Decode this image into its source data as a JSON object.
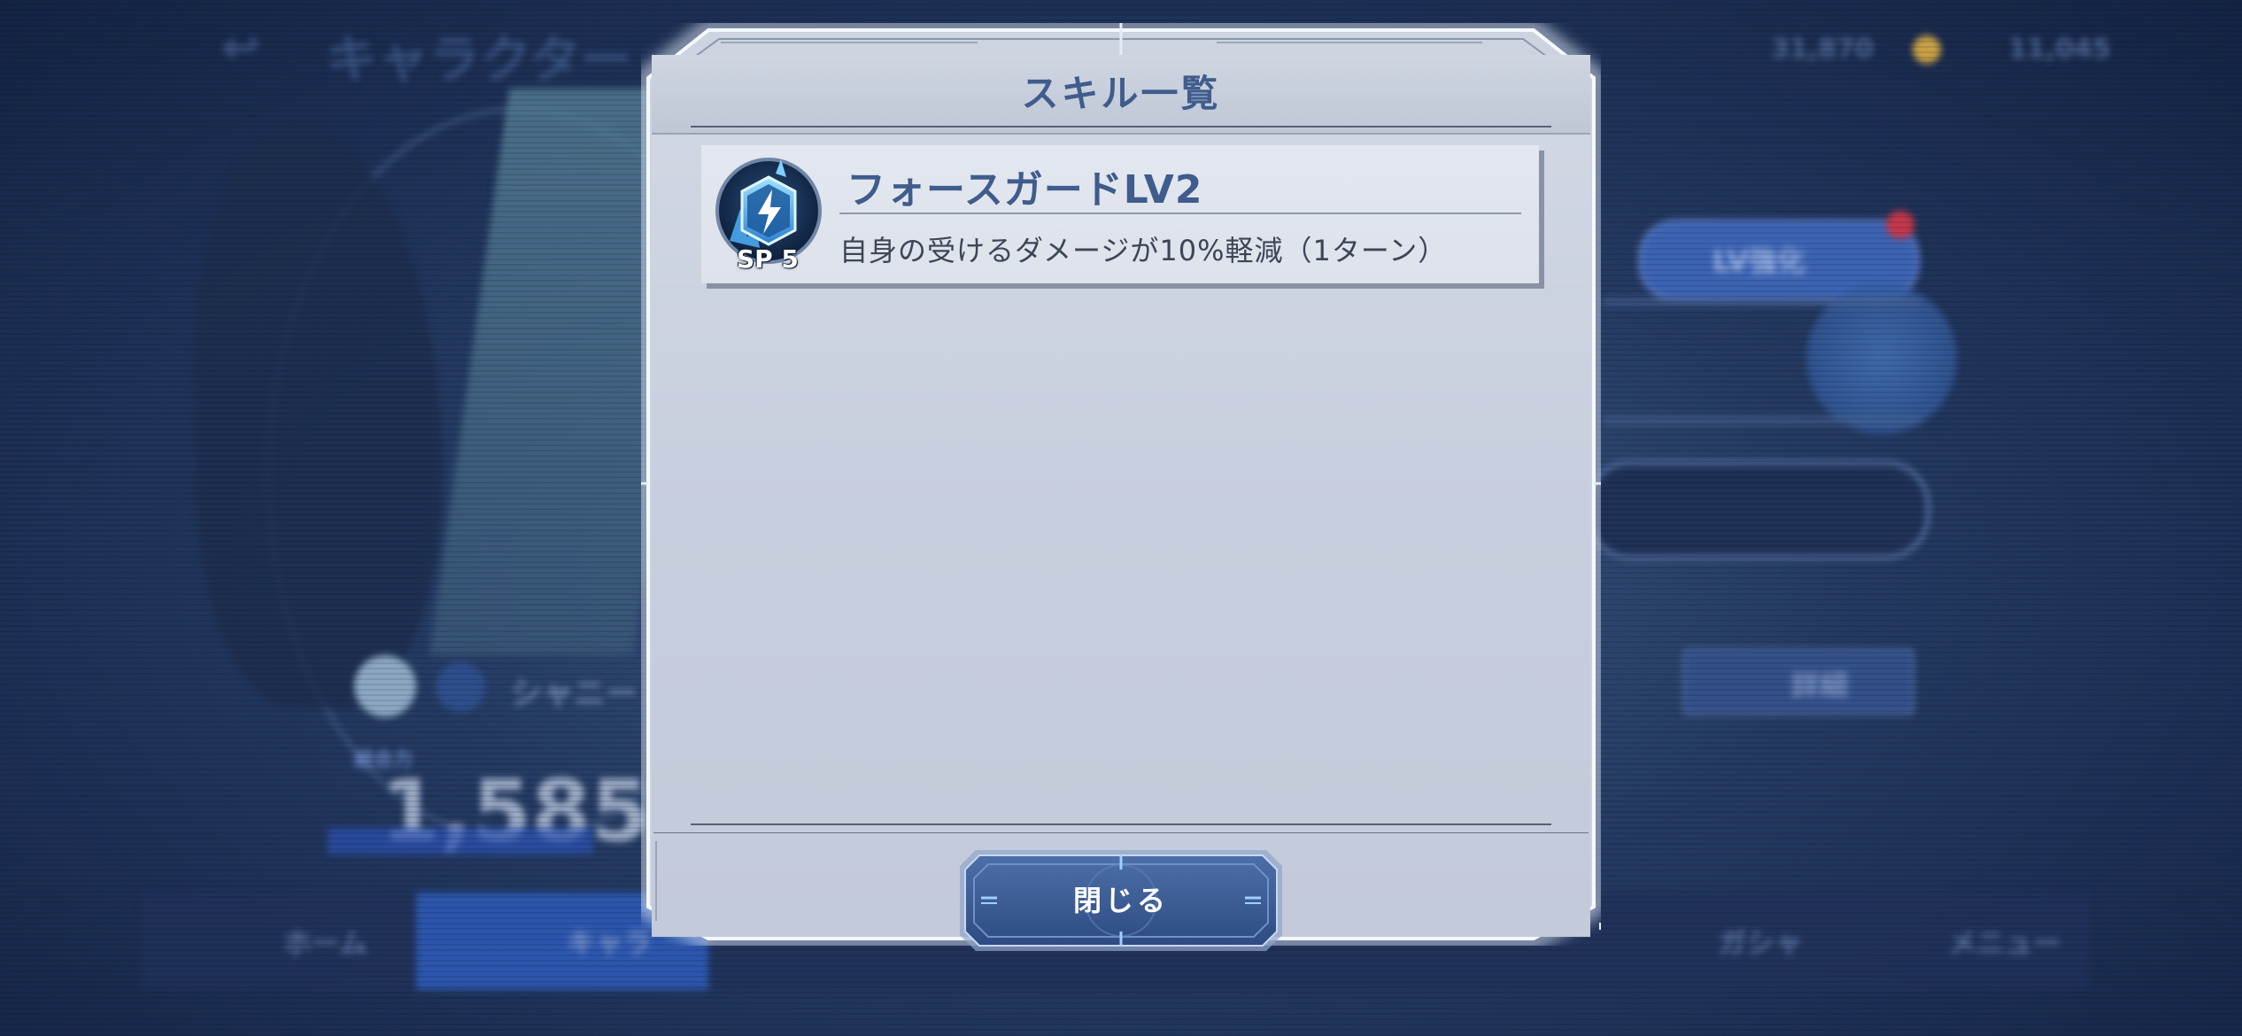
{
  "background": {
    "screen_title": "キャラクター",
    "currency_value": "31,870",
    "gem_value": "11,045",
    "lv_button_label": "LV強化",
    "detail_button_label": "詳細",
    "character_name": "シャニー",
    "power_label": "総合力",
    "power_value": "1,585",
    "nav": [
      "ホーム",
      "キャラ",
      "ガシャ",
      "メニュー"
    ]
  },
  "dialog": {
    "title": "スキル一覧",
    "skills": [
      {
        "name": "フォースガードLV2",
        "description": "自身の受けるダメージが10%軽減（1ターン）",
        "sp": "SP 5",
        "icon": "lightning-shield-icon"
      }
    ],
    "close_label": "閉じる"
  },
  "colors": {
    "accent": "#3f5c8c",
    "panel": "#ccd3df",
    "button": "#3c5b93"
  }
}
